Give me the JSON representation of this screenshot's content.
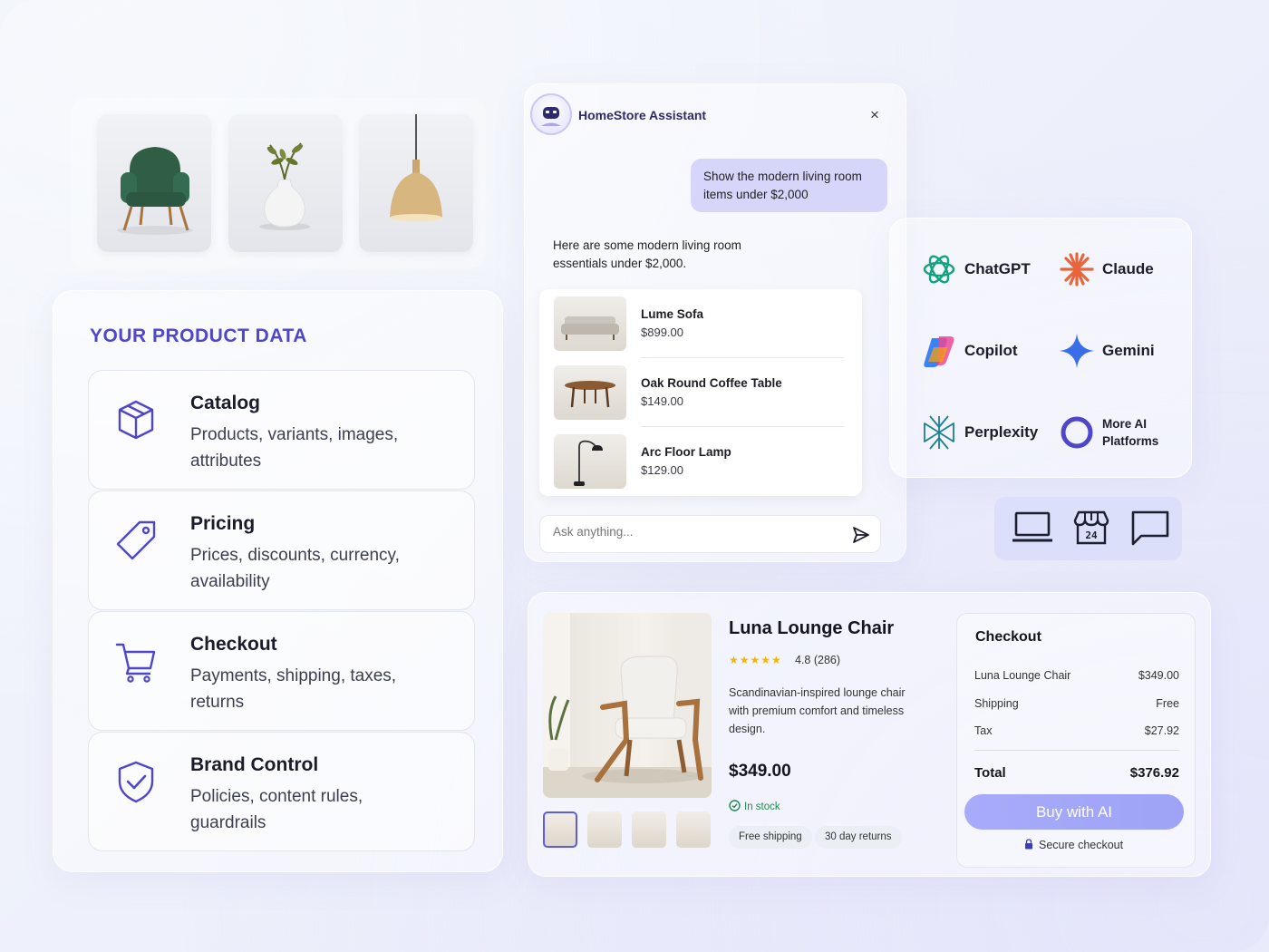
{
  "product_data": {
    "title": "YOUR PRODUCT DATA",
    "cards": [
      {
        "title": "Catalog",
        "desc": "Products, variants, images, attributes"
      },
      {
        "title": "Pricing",
        "desc": "Prices, discounts, currency, availability"
      },
      {
        "title": "Checkout",
        "desc": "Payments, shipping, taxes, returns"
      },
      {
        "title": "Brand Control",
        "desc": "Policies, content rules, guardrails"
      }
    ]
  },
  "chat": {
    "title": "HomeStore Assistant",
    "close": "×",
    "user_message": "Show the modern living room items under $2,000",
    "bot_message": "Here are some modern living room essentials under $2,000.",
    "results": [
      {
        "name": "Lume Sofa",
        "price": "$899.00"
      },
      {
        "name": "Oak Round Coffee Table",
        "price": "$149.00"
      },
      {
        "name": "Arc Floor Lamp",
        "price": "$129.00"
      }
    ],
    "input_placeholder": "Ask anything..."
  },
  "ai_platforms": [
    {
      "name": "ChatGPT"
    },
    {
      "name": "Claude"
    },
    {
      "name": "Copilot"
    },
    {
      "name": "Gemini"
    },
    {
      "name": "Perplexity"
    },
    {
      "name": "More AI Platforms"
    }
  ],
  "channels": [
    "laptop-icon",
    "storefront-24-icon",
    "chat-bubble-icon"
  ],
  "product": {
    "title": "Luna Lounge Chair",
    "stars": "★★★★★",
    "rating": "4.8 (286)",
    "rating_value": 4.8,
    "description": "Scandinavian-inspired lounge chair with premium comfort and timeless design.",
    "price": "$349.00",
    "stock": "In stock",
    "chips": [
      "Free shipping",
      "30 day returns"
    ]
  },
  "checkout": {
    "title": "Checkout",
    "rows": [
      {
        "label": "Luna Lounge Chair",
        "value": "$349.00"
      },
      {
        "label": "Shipping",
        "value": "Free"
      },
      {
        "label": "Tax",
        "value": "$27.92"
      }
    ],
    "total_label": "Total",
    "total_value": "$376.92",
    "buy_label": "Buy with AI",
    "secure_label": "Secure checkout"
  },
  "colors": {
    "accent": "#4f46c9",
    "button": "#a3a6f8",
    "stock": "#1f8b4f",
    "stars": "#f5b400"
  }
}
